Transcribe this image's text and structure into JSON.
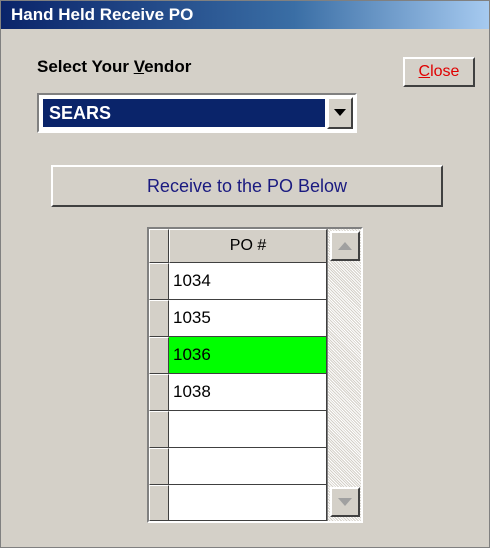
{
  "window": {
    "title": "Hand Held Receive PO"
  },
  "vendor": {
    "label_prefix": "Select Your ",
    "label_mnemonic": "V",
    "label_suffix": "endor",
    "selected": "SEARS"
  },
  "toolbar": {
    "close_mnemonic": "C",
    "close_rest": "lose"
  },
  "actions": {
    "receive_label": "Receive to the PO Below"
  },
  "po_grid": {
    "column_header": "PO #",
    "rows": [
      "1034",
      "1035",
      "1036",
      "1038",
      "",
      "",
      ""
    ],
    "selected_row": 2
  },
  "colors": {
    "title_bar": "#0a246a",
    "selected_row": "#00ff00",
    "close_text": "#e00000",
    "receive_text": "#1a1a80"
  },
  "icons": {
    "dropdown": "chevron-down-icon",
    "scroll_up": "arrow-up-icon",
    "scroll_down": "arrow-down-icon"
  }
}
